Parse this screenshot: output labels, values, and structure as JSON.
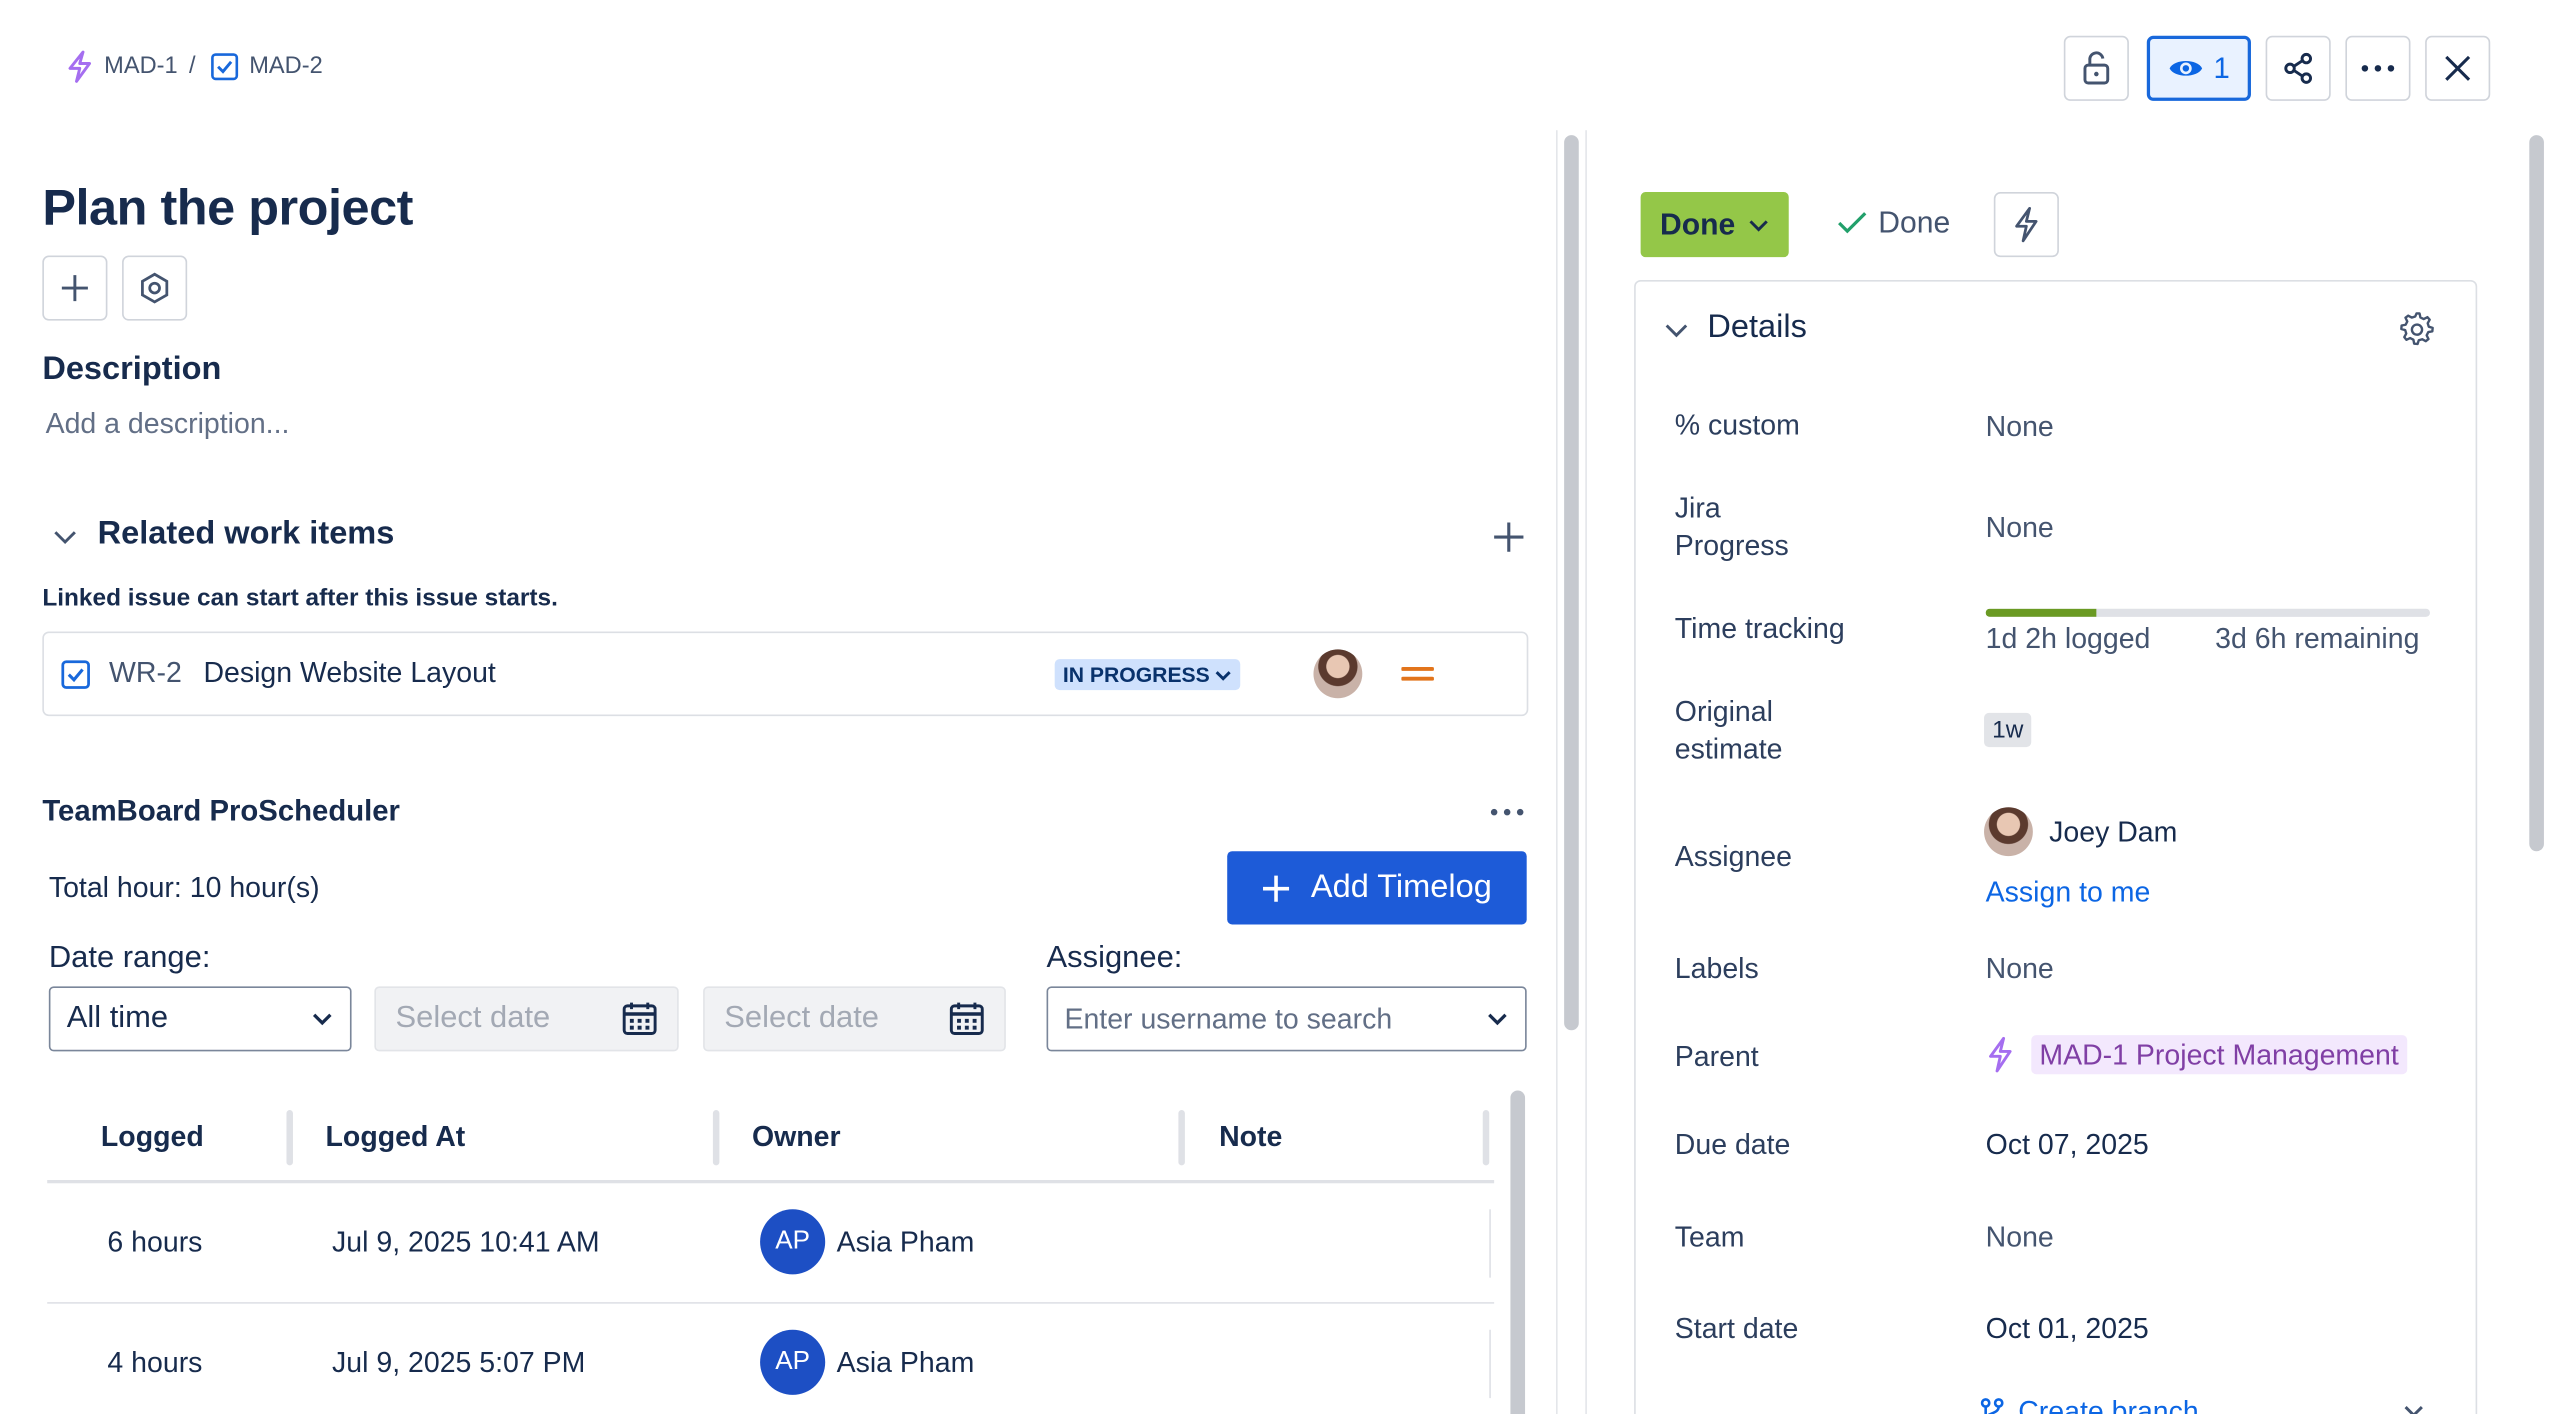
{
  "breadcrumb": {
    "parent_key": "MAD-1",
    "separator": "/",
    "current_key": "MAD-2"
  },
  "toolbar": {
    "watch_count": "1"
  },
  "issue": {
    "title": "Plan the project",
    "description_heading": "Description",
    "description_placeholder": "Add a description..."
  },
  "related": {
    "heading": "Related work items",
    "note": "Linked issue can start after this issue starts.",
    "item": {
      "key": "WR-2",
      "summary": "Design Website Layout",
      "status": "IN PROGRESS"
    }
  },
  "scheduler": {
    "title": "TeamBoard ProScheduler",
    "total_hours": "Total hour: 10 hour(s)",
    "add_button": "Add Timelog",
    "date_range_label": "Date range:",
    "date_range_value": "All time",
    "date_placeholder": "Select date",
    "assignee_label": "Assignee:",
    "assignee_placeholder": "Enter username to search",
    "columns": [
      "Logged",
      "Logged At",
      "Owner",
      "Note"
    ],
    "rows": [
      {
        "logged": "6 hours",
        "logged_at": "Jul 9, 2025 10:41 AM",
        "owner_initials": "AP",
        "owner": "Asia Pham"
      },
      {
        "logged": "4 hours",
        "logged_at": "Jul 9, 2025 5:07 PM",
        "owner_initials": "AP",
        "owner": "Asia Pham"
      }
    ]
  },
  "status": {
    "button": "Done",
    "resolution": "Done"
  },
  "details": {
    "heading": "Details",
    "fields": {
      "custom_label": "% custom",
      "custom_value": "None",
      "jira_progress_label_1": "Jira",
      "jira_progress_label_2": "Progress",
      "jira_progress_value": "None",
      "time_tracking_label": "Time tracking",
      "time_logged": "1d 2h logged",
      "time_remaining": "3d 6h remaining",
      "time_progress": 0.25,
      "original_estimate_label_1": "Original",
      "original_estimate_label_2": "estimate",
      "original_estimate_value": "1w",
      "assignee_label": "Assignee",
      "assignee_name": "Joey Dam",
      "assign_to_me": "Assign to me",
      "labels_label": "Labels",
      "labels_value": "None",
      "parent_label": "Parent",
      "parent_value": "MAD-1 Project Management",
      "due_date_label": "Due date",
      "due_date_value": "Oct 07, 2025",
      "team_label": "Team",
      "team_value": "None",
      "start_date_label": "Start date",
      "start_date_value": "Oct 01, 2025",
      "create_branch": "Create branch"
    }
  },
  "colors": {
    "primary": "#1d5bd8",
    "done": "#94c748",
    "epic": "#a56ef0",
    "progress_fill": "#6a9a23"
  }
}
